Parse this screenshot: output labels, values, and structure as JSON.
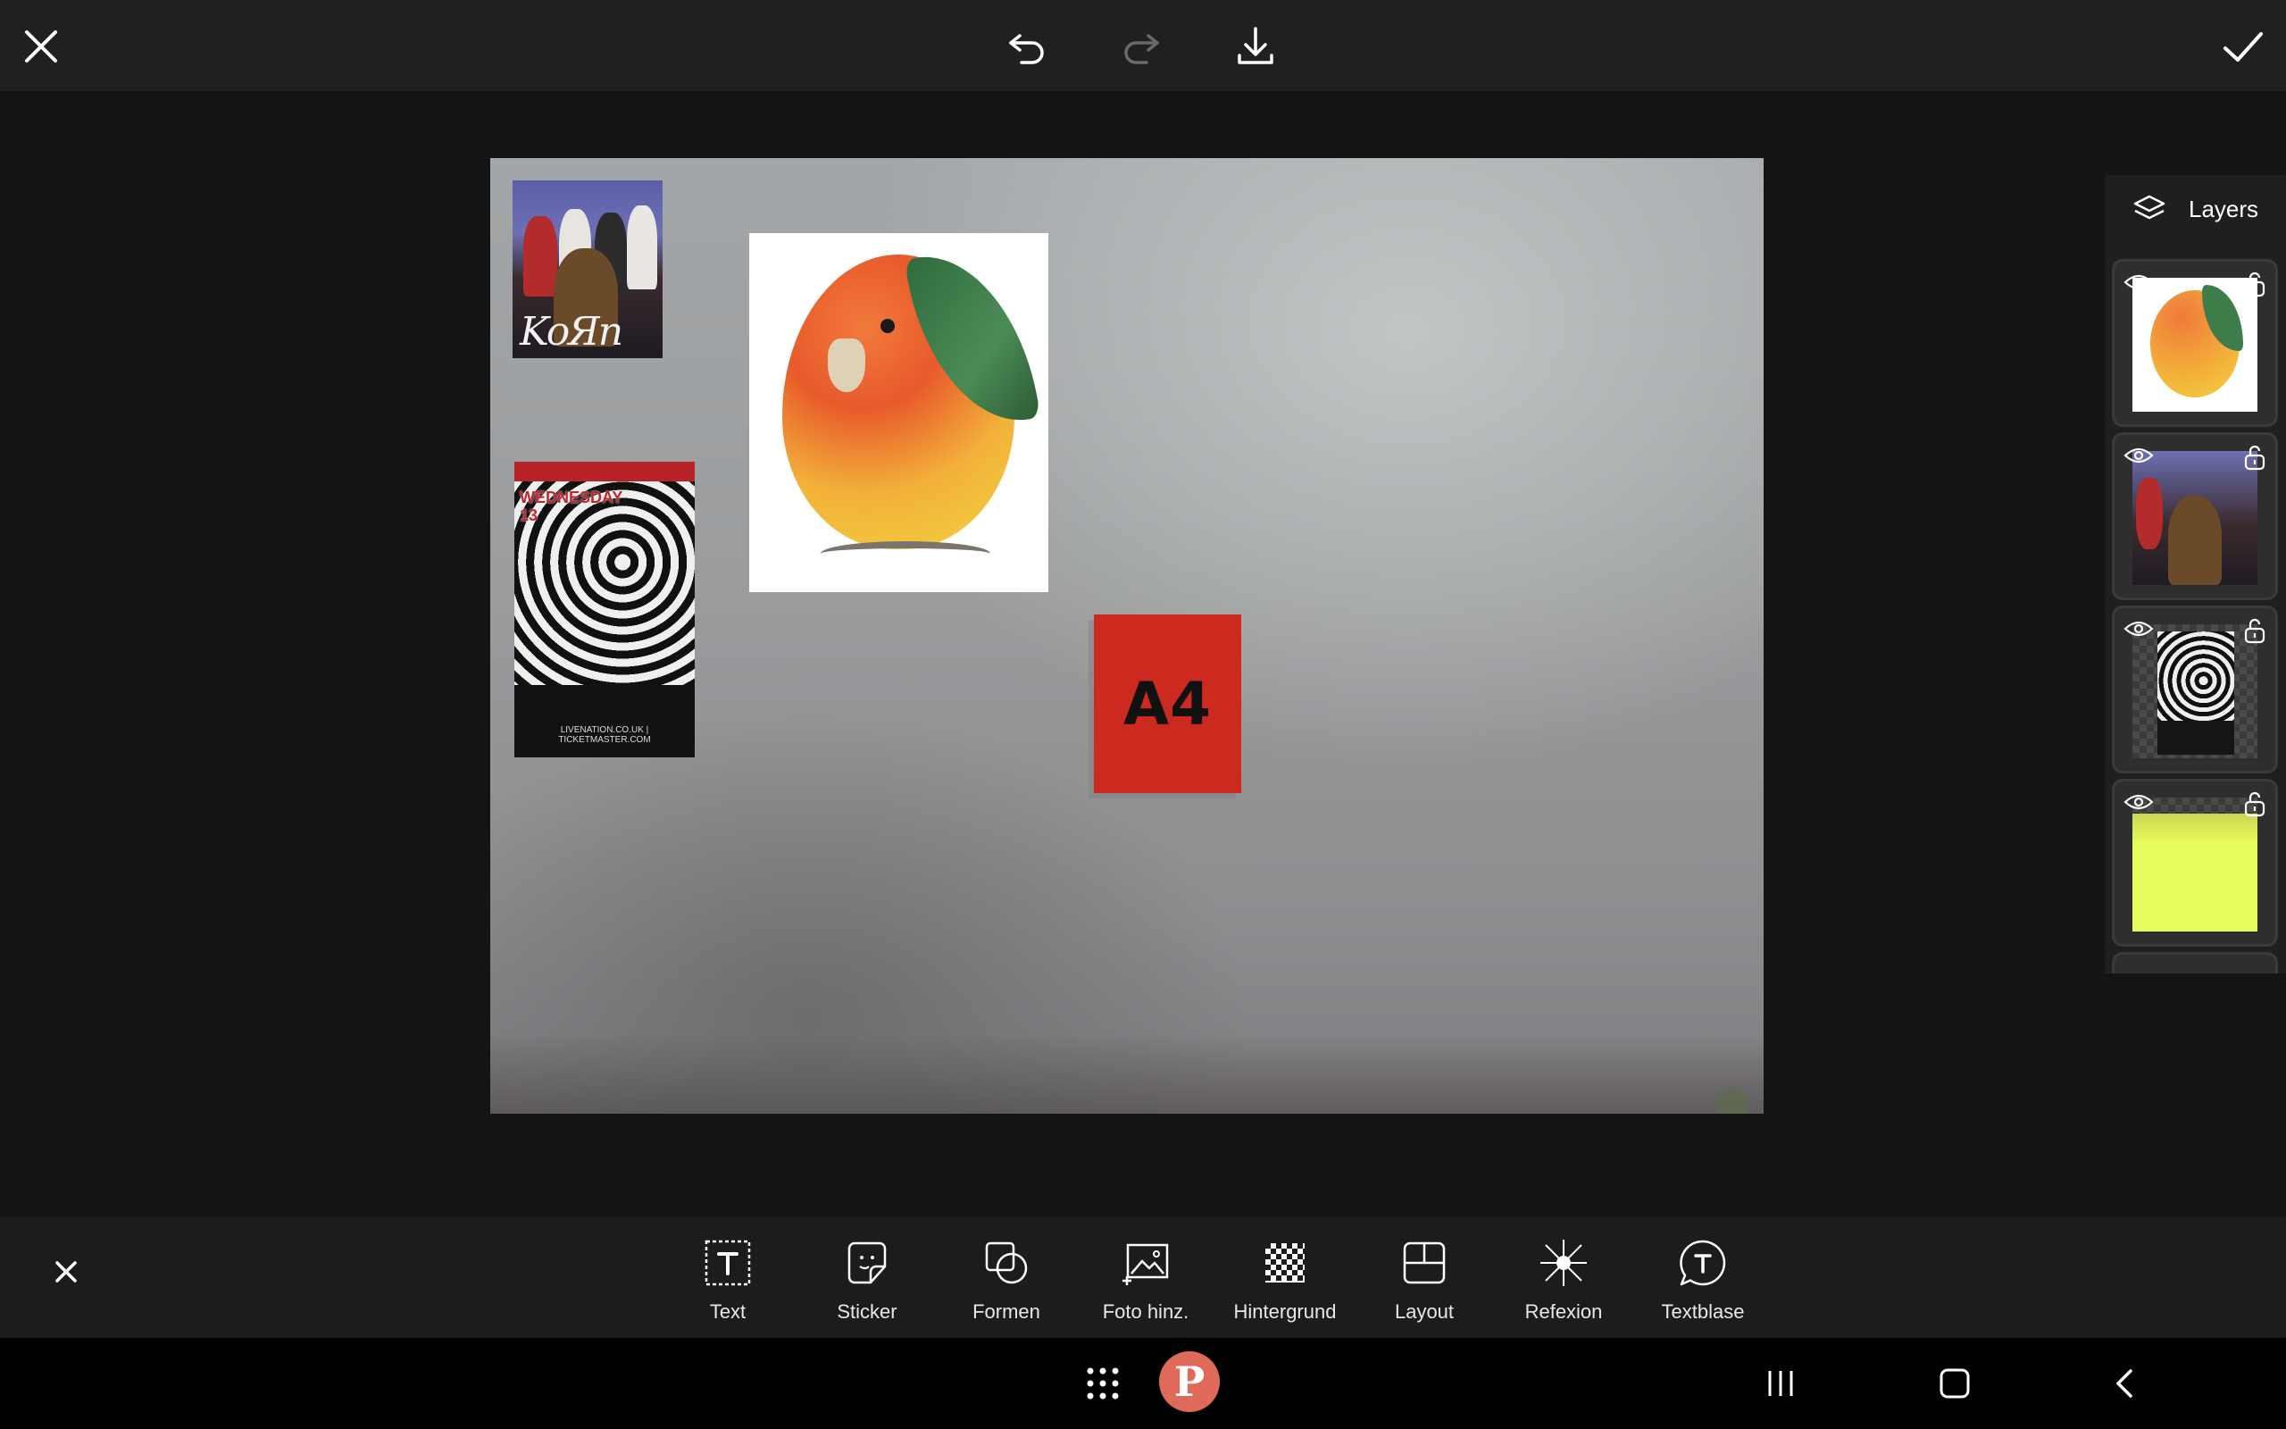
{
  "toolbar": {
    "close": "close-icon",
    "undo": "undo-icon",
    "redo": "redo-icon",
    "download": "download-icon",
    "confirm": "check-icon"
  },
  "canvas": {
    "stickers": [
      {
        "id": "korn",
        "caption": "KoЯn"
      },
      {
        "id": "poster",
        "headline": "WEDNESDAY 13",
        "footer": "LIVENATION.CO.UK | TICKETMASTER.COM"
      },
      {
        "id": "mango-parrot"
      },
      {
        "id": "a4",
        "label": "A4"
      }
    ]
  },
  "layers": {
    "title": "Layers",
    "items": [
      {
        "name": "mango-parrot",
        "visible": true,
        "locked": false
      },
      {
        "name": "korn",
        "visible": true,
        "locked": false
      },
      {
        "name": "poster",
        "visible": true,
        "locked": false
      },
      {
        "name": "yellow-layer",
        "visible": true,
        "locked": false
      }
    ]
  },
  "tools": [
    {
      "label": "Text",
      "icon": "text-icon"
    },
    {
      "label": "Sticker",
      "icon": "sticker-icon"
    },
    {
      "label": "Formen",
      "icon": "shapes-icon"
    },
    {
      "label": "Foto hinz.",
      "icon": "add-photo-icon"
    },
    {
      "label": "Hintergrund",
      "icon": "background-icon"
    },
    {
      "label": "Layout",
      "icon": "layout-icon"
    },
    {
      "label": "Refexion",
      "icon": "reflection-icon"
    },
    {
      "label": "Textblase",
      "icon": "text-bubble-icon"
    }
  ],
  "colors": {
    "topbar": "#202020",
    "background": "#141414",
    "a4_card": "#cc2a1e",
    "yellow_layer": "#e8fb5c",
    "pinterest": "#e06a5a"
  }
}
